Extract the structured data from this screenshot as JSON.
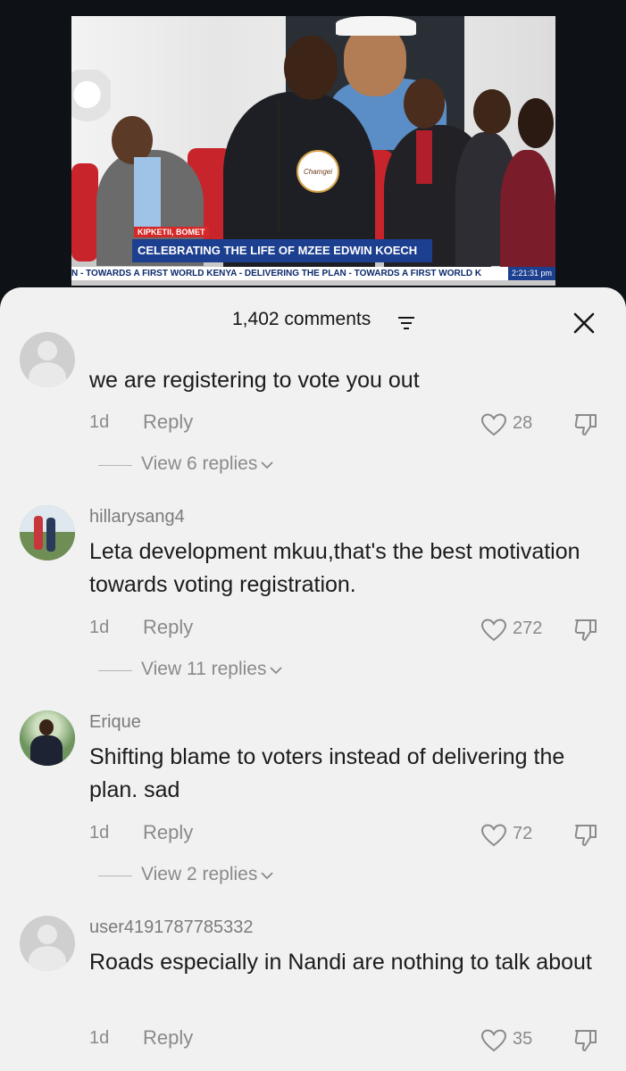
{
  "video": {
    "location_tag": "KIPKETII, BOMET",
    "headline": "CELEBRATING THE LIFE OF MZEE EDWIN KOECH",
    "ticker": "N - TOWARDS A FIRST WORLD KENYA - DELIVERING THE PLAN - TOWARDS A FIRST WORLD K",
    "time": "2:21:31 pm",
    "podium_logo": "Chamgei"
  },
  "sheet": {
    "comments_count": "1,402 comments",
    "comments": [
      {
        "username": "",
        "text": "we are registering to vote you out",
        "time": "1d",
        "reply_label": "Reply",
        "likes": "28",
        "view_replies": "View 6 replies"
      },
      {
        "username": "hillarysang4",
        "text": "Leta development mkuu,that's the best motivation towards voting registration.",
        "time": "1d",
        "reply_label": "Reply",
        "likes": "272",
        "view_replies": "View 11 replies"
      },
      {
        "username": "Erique",
        "text": "Shifting blame to voters instead of delivering the plan. sad",
        "time": "1d",
        "reply_label": "Reply",
        "likes": "72",
        "view_replies": "View 2 replies"
      },
      {
        "username": "user4191787785332",
        "text": "Roads especially in Nandi are nothing to talk about",
        "time": "1d",
        "reply_label": "Reply",
        "likes": "35"
      }
    ]
  },
  "icons": {
    "filter": "filter-icon",
    "close": "close-icon",
    "like": "heart-outline-icon",
    "dislike": "thumbs-down-icon",
    "chevron": "chevron-down-icon"
  },
  "colors": {
    "sheet_bg": "#f1f1f1",
    "meta_text": "#8a8a8a",
    "headline_bg": "#1d3f8f",
    "tag_bg": "#d62828"
  }
}
